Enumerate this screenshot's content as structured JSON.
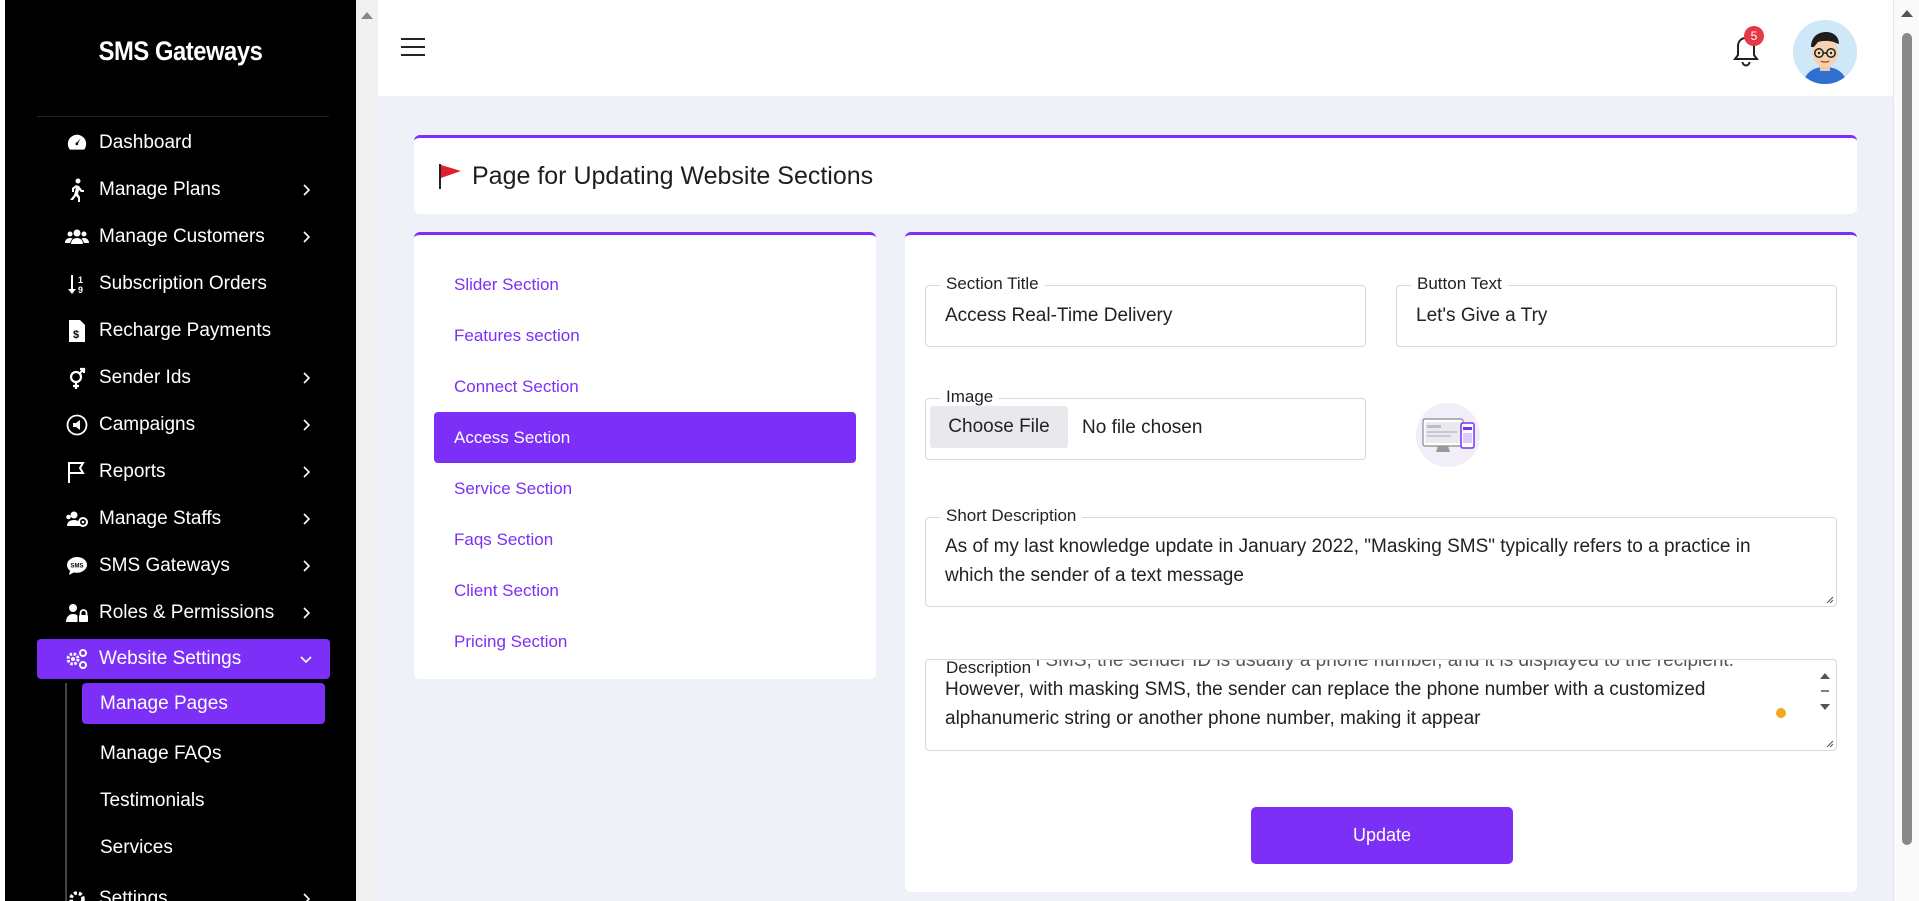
{
  "sidebar": {
    "brand": "SMS Gateways",
    "items": [
      {
        "label": "Dashboard",
        "icon": "gauge-icon",
        "has_children": false
      },
      {
        "label": "Manage Plans",
        "icon": "walking-person-icon",
        "has_children": true
      },
      {
        "label": "Manage Customers",
        "icon": "users-icon",
        "has_children": true
      },
      {
        "label": "Subscription Orders",
        "icon": "sort-arrows-icon",
        "has_children": false
      },
      {
        "label": "Recharge Payments",
        "icon": "invoice-dollar-icon",
        "has_children": false
      },
      {
        "label": "Sender Ids",
        "icon": "gender-icon",
        "has_children": true
      },
      {
        "label": "Campaigns",
        "icon": "campaign-icon",
        "has_children": true
      },
      {
        "label": "Reports",
        "icon": "flag-outline-icon",
        "has_children": true
      },
      {
        "label": "Manage Staffs",
        "icon": "staff-icon",
        "has_children": true
      },
      {
        "label": "SMS Gateways",
        "icon": "sms-bubble-icon",
        "has_children": true
      },
      {
        "label": "Roles & Permissions",
        "icon": "user-lock-icon",
        "has_children": true
      },
      {
        "label": "Website Settings",
        "icon": "gears-icon",
        "has_children": true,
        "active": true
      }
    ],
    "sub_items": [
      {
        "label": "Manage Pages",
        "active": true
      },
      {
        "label": "Manage FAQs"
      },
      {
        "label": "Testimonials"
      },
      {
        "label": "Services"
      }
    ],
    "next_item_label": "Settings"
  },
  "header": {
    "notification_count": "5"
  },
  "page": {
    "title": "Page for Updating Website Sections"
  },
  "tabs": [
    {
      "label": "Slider Section"
    },
    {
      "label": "Features section"
    },
    {
      "label": "Connect Section"
    },
    {
      "label": "Access Section",
      "active": true
    },
    {
      "label": "Service Section"
    },
    {
      "label": "Faqs Section"
    },
    {
      "label": "Client Section"
    },
    {
      "label": "Pricing Section"
    }
  ],
  "form": {
    "section_title_label": "Section Title",
    "section_title_value": "Access Real-Time Delivery",
    "button_text_label": "Button Text",
    "button_text_value": "Let's Give a Try",
    "image_label": "Image",
    "choose_file_label": "Choose File",
    "no_file_text": "No file chosen",
    "short_description_label": "Short Description",
    "short_description_value": "As of my last knowledge update in January 2022, \"Masking SMS\" typically refers to a practice in which the sender of a text message",
    "description_label": "Description",
    "description_partial_line": "In standard SMS, the sender ID is usually a phone number, and it is displayed to the recipient.",
    "description_value": "However, with masking SMS, the sender can replace the phone number with a customized alphanumeric string or another phone number, making it appear",
    "update_label": "Update"
  },
  "colors": {
    "accent": "#7b2ff7",
    "sidebar_bg": "#000000",
    "content_bg": "#eef1f8",
    "badge": "#e63946"
  }
}
